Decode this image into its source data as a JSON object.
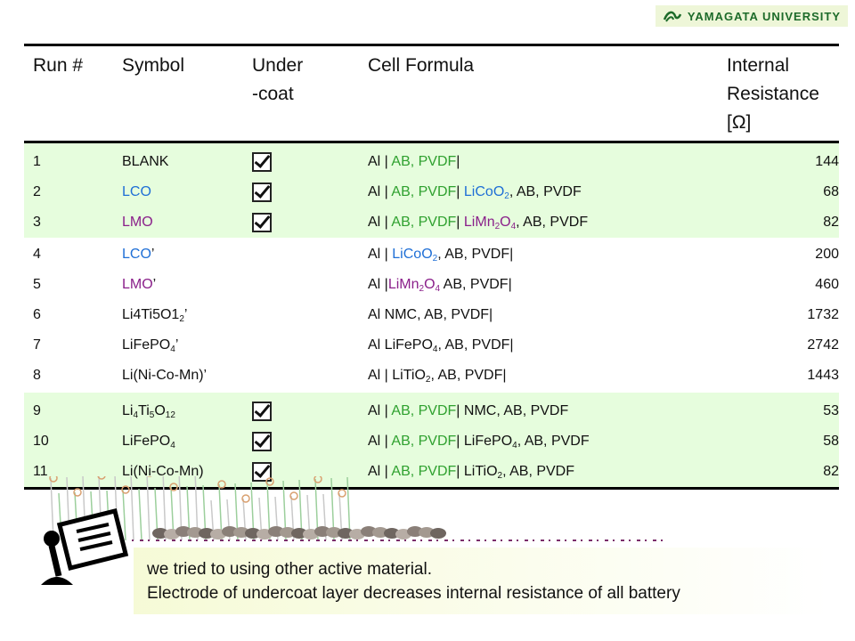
{
  "logo": {
    "text": "YAMAGATA UNIVERSITY",
    "icon": "university-crest-icon",
    "color": "#1d6b2a"
  },
  "table": {
    "headers": [
      {
        "lines": [
          "Run #"
        ]
      },
      {
        "lines": [
          "Symbol"
        ]
      },
      {
        "lines": [
          "Under",
          "-coat"
        ]
      },
      {
        "lines": [
          "Cell Formula"
        ]
      },
      {
        "lines": [
          "Internal",
          "Resistance [Ω]"
        ]
      }
    ],
    "rows": [
      {
        "run": "1",
        "symbol": [
          {
            "t": "BLANK",
            "c": ""
          }
        ],
        "undercoat": true,
        "formula": [
          {
            "t": "Al | ",
            "c": ""
          },
          {
            "t": "AB, PVDF",
            "c": "green"
          },
          {
            "t": "|",
            "c": ""
          }
        ],
        "resistance": "144"
      },
      {
        "run": "2",
        "symbol": [
          {
            "t": "LCO",
            "c": "blue"
          }
        ],
        "undercoat": true,
        "formula": [
          {
            "t": "Al | ",
            "c": ""
          },
          {
            "t": "AB, PVDF",
            "c": "green"
          },
          {
            "t": "| ",
            "c": ""
          },
          {
            "t": "LiCoO",
            "c": "blue"
          },
          {
            "t": "2",
            "c": "blue",
            "sub": true
          },
          {
            "t": ", AB, PVDF",
            "c": ""
          }
        ],
        "resistance": "68"
      },
      {
        "run": "3",
        "symbol": [
          {
            "t": "LMO",
            "c": "purple"
          }
        ],
        "undercoat": true,
        "formula": [
          {
            "t": "Al | ",
            "c": ""
          },
          {
            "t": "AB, PVDF",
            "c": "green"
          },
          {
            "t": "| ",
            "c": ""
          },
          {
            "t": "LiMn",
            "c": "purple"
          },
          {
            "t": "2",
            "c": "purple",
            "sub": true
          },
          {
            "t": "O",
            "c": "purple"
          },
          {
            "t": "4",
            "c": "purple",
            "sub": true
          },
          {
            "t": ", AB, PVDF",
            "c": ""
          }
        ],
        "resistance": "82"
      },
      {
        "run": "4",
        "symbol": [
          {
            "t": "LCO",
            "c": "blue"
          },
          {
            "t": "’",
            "c": ""
          }
        ],
        "undercoat": false,
        "formula": [
          {
            "t": "Al | ",
            "c": ""
          },
          {
            "t": "LiCoO",
            "c": "blue"
          },
          {
            "t": "2",
            "c": "blue",
            "sub": true
          },
          {
            "t": ", AB, PVDF|",
            "c": ""
          }
        ],
        "resistance": "200"
      },
      {
        "run": "5",
        "symbol": [
          {
            "t": "LMO",
            "c": "purple"
          },
          {
            "t": "’",
            "c": ""
          }
        ],
        "undercoat": false,
        "formula": [
          {
            "t": "Al |",
            "c": ""
          },
          {
            "t": "LiMn",
            "c": "purple"
          },
          {
            "t": "2",
            "c": "purple",
            "sub": true
          },
          {
            "t": "O",
            "c": "purple"
          },
          {
            "t": "4",
            "c": "purple",
            "sub": true
          },
          {
            "t": " AB, PVDF|",
            "c": ""
          }
        ],
        "resistance": "460"
      },
      {
        "run": "6",
        "symbol": [
          {
            "t": "Li4Ti5O1",
            "c": ""
          },
          {
            "t": "2",
            "c": "",
            "sub": true
          },
          {
            "t": "’",
            "c": ""
          }
        ],
        "undercoat": false,
        "formula": [
          {
            "t": "Al NMC, AB, PVDF|",
            "c": ""
          }
        ],
        "resistance": "1732"
      },
      {
        "run": "7",
        "symbol": [
          {
            "t": "LiFePO",
            "c": ""
          },
          {
            "t": "4",
            "c": "",
            "sub": true
          },
          {
            "t": "’",
            "c": ""
          }
        ],
        "undercoat": false,
        "formula": [
          {
            "t": "Al LiFePO",
            "c": ""
          },
          {
            "t": "4",
            "c": "",
            "sub": true
          },
          {
            "t": ", AB, PVDF|",
            "c": ""
          }
        ],
        "resistance": "2742"
      },
      {
        "run": "8",
        "symbol": [
          {
            "t": "Li(Ni-Co-Mn)’",
            "c": ""
          }
        ],
        "undercoat": false,
        "formula": [
          {
            "t": "Al | LiTiO",
            "c": ""
          },
          {
            "t": "2",
            "c": "",
            "sub": true
          },
          {
            "t": ", AB, PVDF|",
            "c": ""
          }
        ],
        "resistance": "1443"
      },
      {
        "run": "9",
        "symbol": [
          {
            "t": "Li",
            "c": ""
          },
          {
            "t": "4",
            "c": "",
            "sub": true
          },
          {
            "t": "Ti",
            "c": ""
          },
          {
            "t": "5",
            "c": "",
            "sub": true
          },
          {
            "t": "O",
            "c": ""
          },
          {
            "t": "12",
            "c": "",
            "sub": true
          }
        ],
        "undercoat": true,
        "formula": [
          {
            "t": "Al | ",
            "c": ""
          },
          {
            "t": "AB, PVDF",
            "c": "green"
          },
          {
            "t": "| NMC, AB, PVDF",
            "c": ""
          }
        ],
        "resistance": "53"
      },
      {
        "run": "10",
        "symbol": [
          {
            "t": "LiFePO",
            "c": ""
          },
          {
            "t": "4",
            "c": "",
            "sub": true
          }
        ],
        "undercoat": true,
        "formula": [
          {
            "t": "Al | ",
            "c": ""
          },
          {
            "t": "AB, PVDF",
            "c": "green"
          },
          {
            "t": "| LiFePO",
            "c": ""
          },
          {
            "t": "4",
            "c": "",
            "sub": true
          },
          {
            "t": ", AB, PVDF",
            "c": ""
          }
        ],
        "resistance": "58"
      },
      {
        "run": "11",
        "symbol": [
          {
            "t": "Li(Ni-Co-Mn)",
            "c": ""
          }
        ],
        "undercoat": true,
        "formula": [
          {
            "t": "Al | ",
            "c": ""
          },
          {
            "t": "AB, PVDF",
            "c": "green"
          },
          {
            "t": "| LiTiO",
            "c": ""
          },
          {
            "t": "2",
            "c": "",
            "sub": true
          },
          {
            "t": ", AB, PVDF",
            "c": ""
          }
        ],
        "resistance": "82"
      }
    ]
  },
  "notes": {
    "icon": "presenter-board-icon",
    "lines": [
      "we tried to using other active material.",
      "Electrode of undercoat layer decreases internal  resistance of all battery"
    ]
  },
  "colors": {
    "green_row": "#e6fddd",
    "green_text": "#2fa12f",
    "blue_text": "#1f6fd6",
    "purple_text": "#8a1f8a"
  }
}
